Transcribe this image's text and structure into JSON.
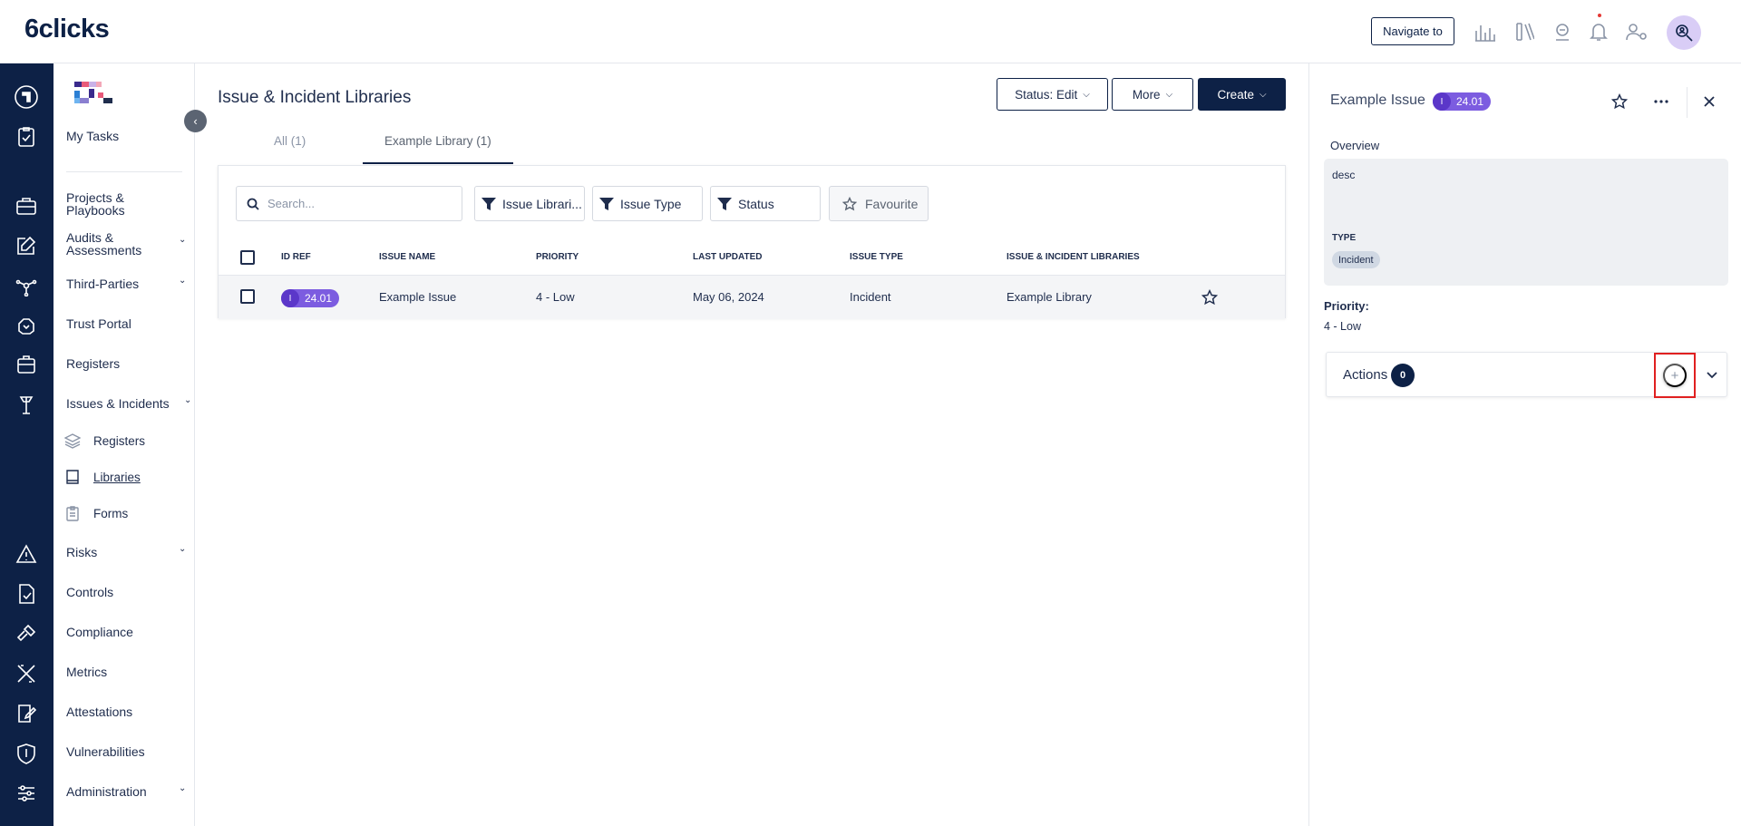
{
  "brand": {
    "logo_text": "6clicks"
  },
  "topbar": {
    "navigate_label": "Navigate to",
    "icons": [
      "analytics-icon",
      "library-icon",
      "trust-icon",
      "bell-icon",
      "user-settings-icon",
      "search-user-icon"
    ]
  },
  "sidebar": {
    "items": [
      {
        "label": "My Tasks"
      },
      {
        "label": "Projects &\nPlaybooks"
      },
      {
        "label": "Audits &\nAssessments"
      },
      {
        "label": "Third-Parties"
      },
      {
        "label": "Trust Portal"
      },
      {
        "label": "Registers"
      },
      {
        "label": "Issues & Incidents"
      },
      {
        "label": "Risks"
      },
      {
        "label": "Controls"
      },
      {
        "label": "Compliance"
      },
      {
        "label": "Metrics"
      },
      {
        "label": "Attestations"
      },
      {
        "label": "Vulnerabilities"
      },
      {
        "label": "Administration"
      }
    ],
    "subitems": [
      {
        "label": "Registers"
      },
      {
        "label": "Libraries"
      },
      {
        "label": "Forms"
      }
    ]
  },
  "main": {
    "title": "Issue & Incident Libraries",
    "status_prefix": "Status:",
    "status_value": "Edit",
    "more_label": "More",
    "create_label": "Create",
    "tabs": [
      {
        "label": "All (1)"
      },
      {
        "label": "Example Library (1)"
      }
    ],
    "search_placeholder": "Search...",
    "filters": [
      {
        "label": "Issue Librari..."
      },
      {
        "label": "Issue Type"
      },
      {
        "label": "Status"
      }
    ],
    "favourite_label": "Favourite",
    "columns": [
      "ID REF",
      "ISSUE NAME",
      "PRIORITY",
      "LAST UPDATED",
      "ISSUE TYPE",
      "ISSUE & INCIDENT LIBRARIES"
    ],
    "rows": [
      {
        "id_prefix": "I",
        "id": "24.01",
        "name": "Example Issue",
        "priority": "4 - Low",
        "last_updated": "May 06, 2024",
        "type": "Incident",
        "library": "Example Library"
      }
    ]
  },
  "panel": {
    "title": "Example Issue",
    "id_prefix": "I",
    "id": "24.01",
    "overview_label": "Overview",
    "description": "desc",
    "type_label": "TYPE",
    "type_value": "Incident",
    "priority_label": "Priority:",
    "priority_value": "4 - Low",
    "actions_label": "Actions",
    "actions_count": "0",
    "add_glyph": "+"
  },
  "colors": {
    "navy": "#0d2146",
    "purple_badge": "#7c5ce0",
    "highlight_red": "#e02020"
  }
}
